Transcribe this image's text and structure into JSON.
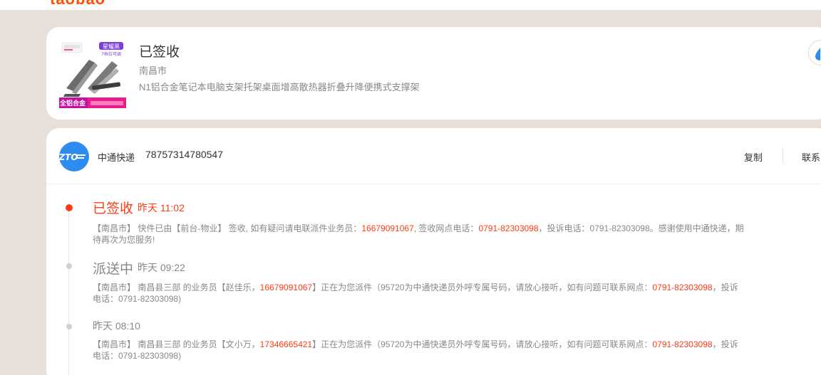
{
  "top": {
    "logo_fragment": "taobao"
  },
  "order": {
    "status": "已签收",
    "city": "南昌市",
    "product_name": "N1铝合金笔记本电脑支架托架桌面增高散热器折叠升降便携式支撑架",
    "thumb_badge_top": "星耀黑",
    "thumb_badge_sub": "7档位可调",
    "thumb_badge_bottom": "全铝合金"
  },
  "logistics": {
    "courier_name": "中通快递",
    "courier_logo_text": "ZTO",
    "tracking_number": "78757314780547",
    "copy_label": "复制",
    "contact_label": "联系",
    "events": [
      {
        "status": "已签收",
        "time": "昨天 11:02",
        "desc": {
          "p1": "【南昌市】 快件已由【前台-物业】 签收, 如有疑问请电联派件业务员：",
          "phone1": "16679091067",
          "p2": ", 签收网点电话：",
          "phone2": "0791-82303098",
          "p3": "，投诉电话：0791-82303098。感谢使用中通快递，期待再次为您服务!"
        }
      },
      {
        "status": "派送中",
        "time": "昨天 09:22",
        "desc": {
          "p1": "【南昌市】 南昌县三部 的业务员【赵佳乐，",
          "phone1": "16679091067",
          "p2": "】正在为您派件（95720为中通快递员外呼专属号码，请放心接听，如有问题可联系网点：",
          "phone2": "0791-82303098",
          "p3": "，投诉电话：0791-82303098)"
        }
      },
      {
        "status": "",
        "time": "昨天 08:10",
        "desc": {
          "p1": "【南昌市】 南昌县三部 的业务员【文小万，",
          "phone1": "17346665421",
          "p2": "】正在为您派件（95720为中通快递员外呼专属号码，请放心接听，如有问题可联系网点：",
          "phone2": "0791-82303098",
          "p3": "，投诉电话：0791-82303098)"
        }
      }
    ]
  },
  "colors": {
    "accent": "#ff3c14",
    "courier_blue": "#2e8cf0",
    "page_bg": "#e7dfd9"
  }
}
